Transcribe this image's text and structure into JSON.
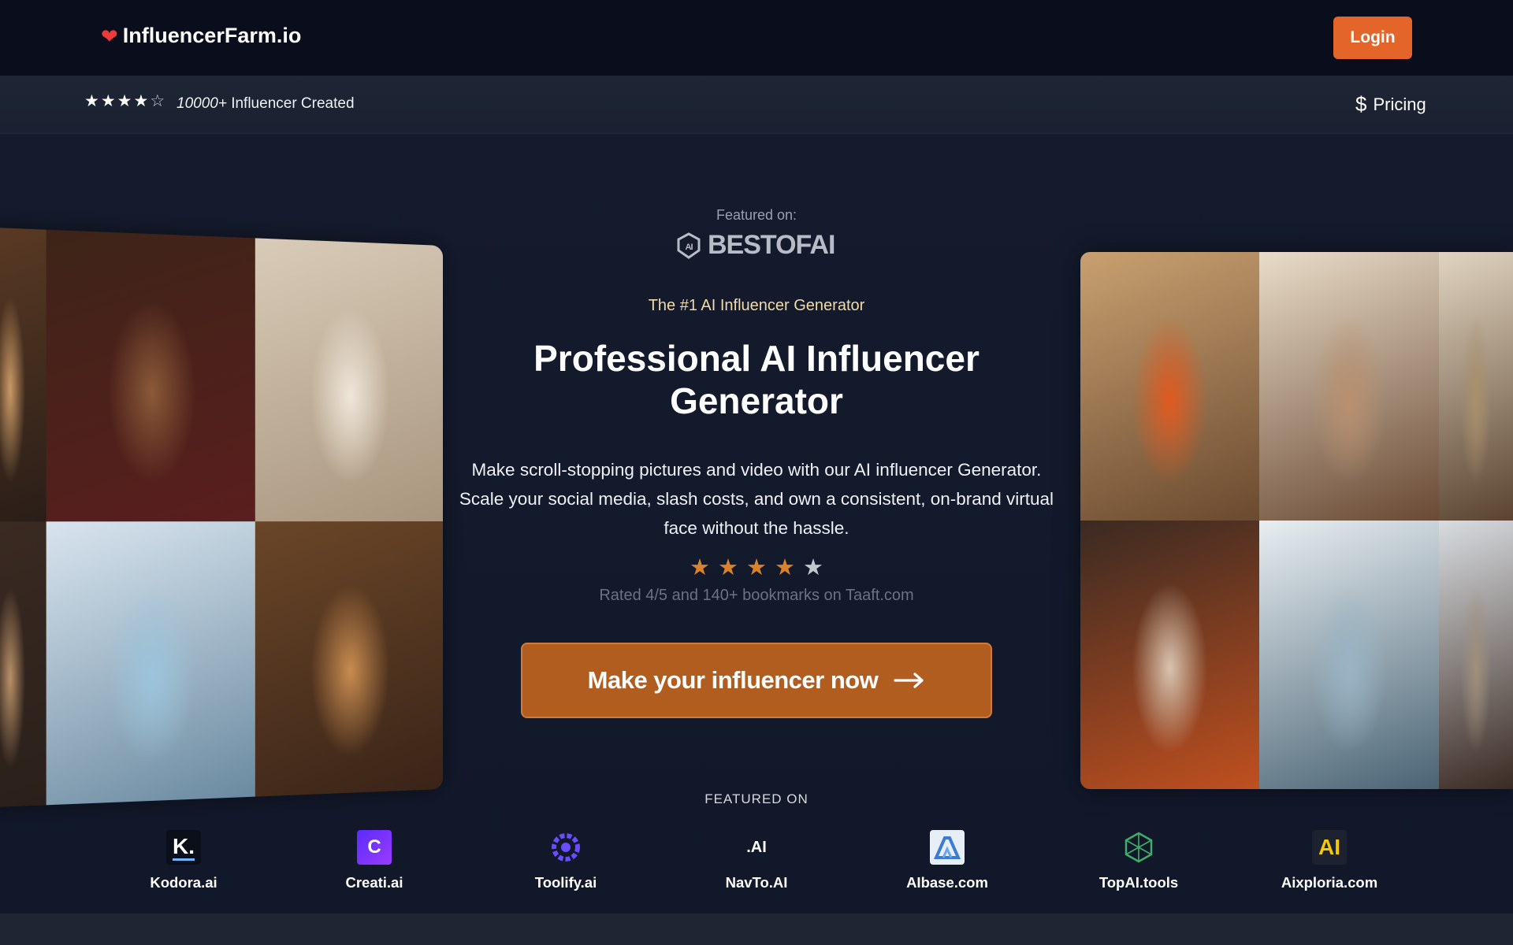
{
  "nav": {
    "brand": "InfluencerFarm.io",
    "login_label": "Login"
  },
  "subbar": {
    "rating_stars": {
      "filled": 4,
      "total": 5
    },
    "count_italic": "10000+",
    "count_label": " Influencer Created",
    "pricing_label": "Pricing"
  },
  "hero": {
    "featured_label": "Featured on:",
    "featured_brand": "BESTOFAI",
    "tagline": "The #1 AI Influencer Generator",
    "headline": "Professional AI Influencer Generator",
    "description": "Make scroll-stopping pictures and video with our AI influencer Generator. Scale your social media, slash costs, and own a consistent, on-brand virtual face without the hassle.",
    "rating": {
      "filled": 4,
      "total": 5
    },
    "rating_text": "Rated 4/5 and 140+ bookmarks on Taaft.com",
    "cta_label": "Make your influencer now"
  },
  "gallery_left": [
    {
      "name": "photo-woman-balcony",
      "colors": [
        "#5a3a24",
        "#c99a66",
        "#2a1e18"
      ]
    },
    {
      "name": "photo-woman-black-gown",
      "colors": [
        "#3d2418",
        "#8a5a38",
        "#5a1e1e"
      ]
    },
    {
      "name": "photo-woman-bed",
      "colors": [
        "#d8cbb8",
        "#efe6da",
        "#a8957d"
      ]
    },
    {
      "name": "photo-woman-hair",
      "colors": [
        "#3a2a22",
        "#b89068",
        "#2a201a"
      ]
    },
    {
      "name": "photo-glacier-hiker",
      "colors": [
        "#d8e4ee",
        "#9cc4dc",
        "#6a8aa0"
      ]
    },
    {
      "name": "photo-woman-dinner",
      "colors": [
        "#6a4628",
        "#c88c50",
        "#3a2418"
      ]
    }
  ],
  "gallery_right": [
    {
      "name": "photo-woman-orange-coat",
      "colors": [
        "#c8a070",
        "#e05a20",
        "#6a4a30"
      ]
    },
    {
      "name": "photo-man-private-jet",
      "colors": [
        "#e8dcc8",
        "#b89070",
        "#6a4a34"
      ]
    },
    {
      "name": "photo-woman-jet-partial",
      "colors": [
        "#e0d4c0",
        "#a8906c",
        "#5a4430"
      ]
    },
    {
      "name": "photo-woman-lace-dress",
      "colors": [
        "#3a2a22",
        "#d8c4b0",
        "#c05020"
      ]
    },
    {
      "name": "photo-woman-hot-spring",
      "colors": [
        "#e8eef2",
        "#9ab4c4",
        "#4a6474"
      ]
    },
    {
      "name": "photo-woman-partial",
      "colors": [
        "#d8dce0",
        "#a0907c",
        "#3a2a22"
      ]
    }
  ],
  "featured_on": {
    "label": "FEATURED ON",
    "partners": [
      {
        "name": "Kodora.ai",
        "icon": "kodora-logo",
        "mark": "K."
      },
      {
        "name": "Creati.ai",
        "icon": "creati-logo",
        "mark": "C"
      },
      {
        "name": "Toolify.ai",
        "icon": "toolify-logo",
        "mark": ""
      },
      {
        "name": "NavTo.AI",
        "icon": "navto-logo",
        "mark": ".AI"
      },
      {
        "name": "AIbase.com",
        "icon": "aibase-logo",
        "mark": ""
      },
      {
        "name": "TopAI.tools",
        "icon": "topai-logo",
        "mark": ""
      },
      {
        "name": "Aixploria.com",
        "icon": "aixploria-logo",
        "mark": "AI"
      }
    ]
  },
  "colors": {
    "accent": "#e3652a",
    "cta": "#b25d20",
    "star": "#d9822b",
    "background": "#131a2b",
    "nav": "#090d1c"
  }
}
